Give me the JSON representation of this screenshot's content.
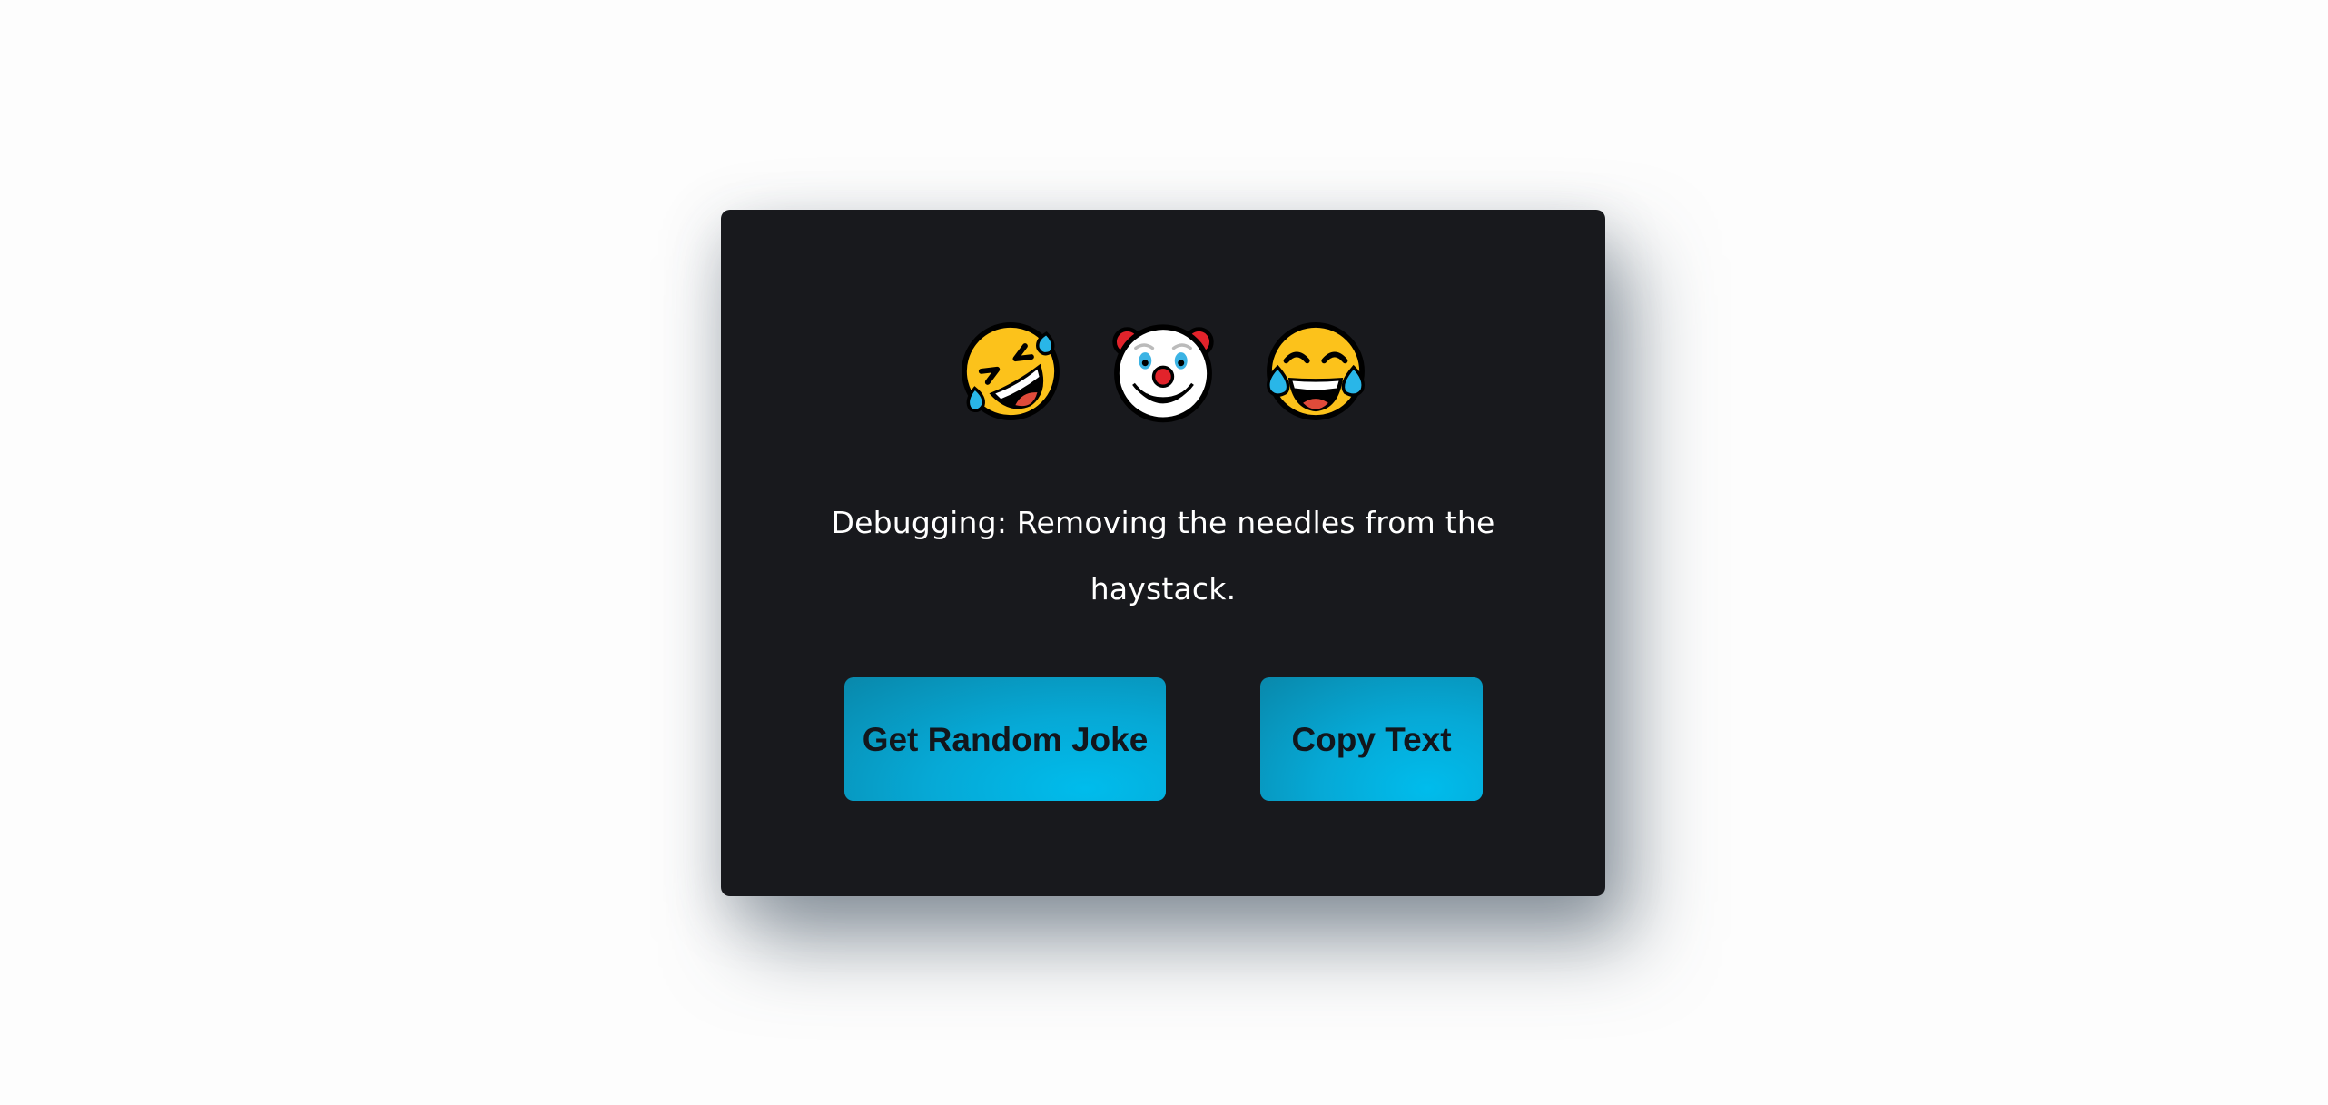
{
  "emojis": [
    "rolling-on-floor-laughing",
    "clown-face",
    "face-with-tears-of-joy"
  ],
  "joke": {
    "text": "Debugging: Removing the needles from the haystack."
  },
  "buttons": {
    "random_joke": "Get Random Joke",
    "copy_text": "Copy Text"
  },
  "colors": {
    "page_background": "#fdfdfd",
    "card_background": "#18191d",
    "button_accent": "#00bcec",
    "button_text": "#12161c",
    "joke_text": "#ffffff"
  }
}
